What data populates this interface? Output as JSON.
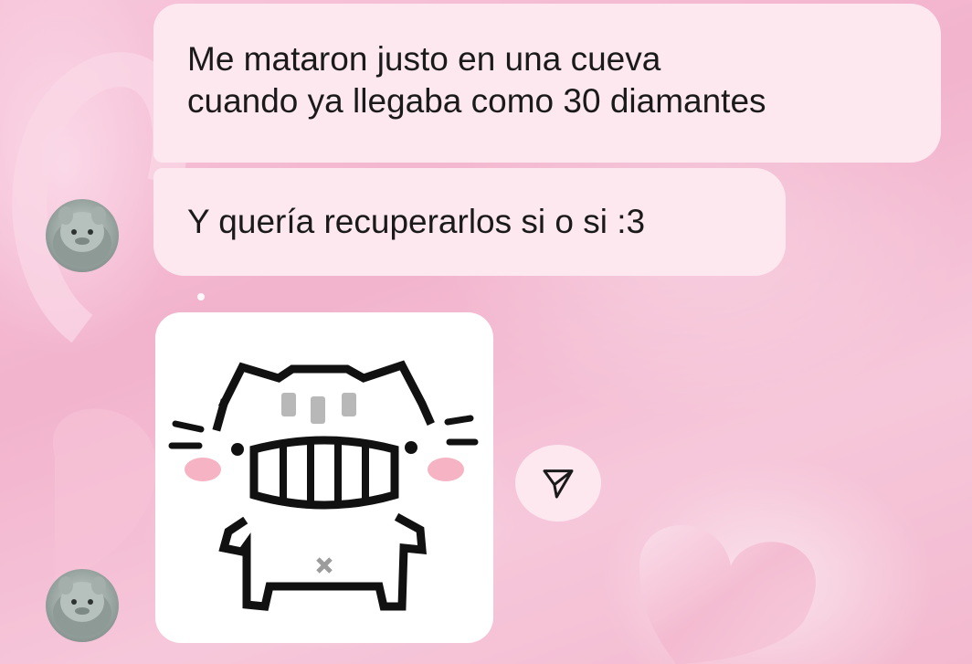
{
  "messages": [
    {
      "lines": [
        "Me mataron justo en una cueva",
        "cuando ya llegaba como 30 diamantes"
      ]
    },
    {
      "lines": [
        "Y quería recuperarlos si o si :3"
      ]
    }
  ],
  "sticker": {
    "icon": "cat-grin-sticker"
  },
  "actions": {
    "share_icon": "send-paper-plane-icon"
  },
  "colors": {
    "bubble": "#fde8f0",
    "background": "#f2b3cc",
    "text": "#1a1a1a"
  }
}
